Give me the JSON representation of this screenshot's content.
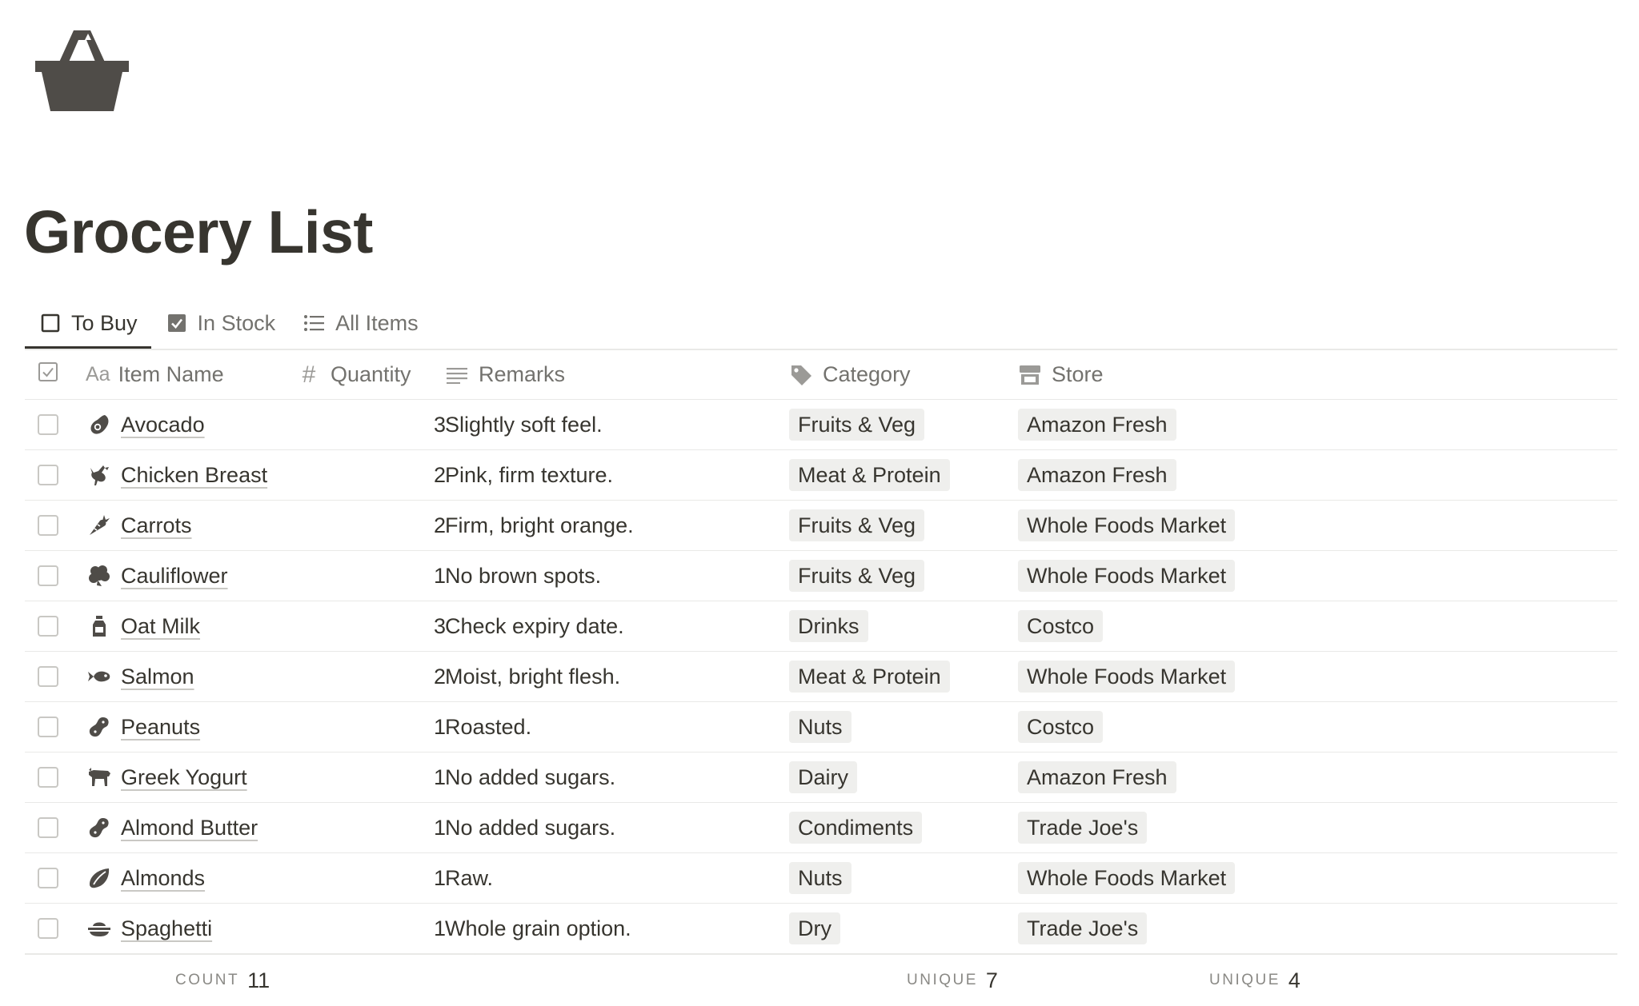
{
  "page": {
    "icon": "shopping-basket-icon",
    "title": "Grocery List"
  },
  "tabs": [
    {
      "label": "To Buy",
      "icon": "checkbox-empty-icon",
      "active": true
    },
    {
      "label": "In Stock",
      "icon": "checkbox-checked-icon",
      "active": false
    },
    {
      "label": "All Items",
      "icon": "list-icon",
      "active": false
    }
  ],
  "table": {
    "columns": {
      "name": {
        "label": "Item Name",
        "icon": "text-aa-icon"
      },
      "quantity": {
        "label": "Quantity",
        "icon": "hash-icon"
      },
      "remarks": {
        "label": "Remarks",
        "icon": "lines-icon"
      },
      "category": {
        "label": "Category",
        "icon": "tag-icon"
      },
      "store": {
        "label": "Store",
        "icon": "store-icon"
      }
    },
    "rows": [
      {
        "name": "Avocado",
        "icon": "avocado-icon",
        "quantity": "3",
        "remarks": "Slightly soft feel.",
        "category": "Fruits & Veg",
        "store": "Amazon Fresh"
      },
      {
        "name": "Chicken Breast",
        "icon": "chicken-icon",
        "quantity": "2",
        "remarks": "Pink, firm texture.",
        "category": "Meat & Protein",
        "store": "Amazon Fresh"
      },
      {
        "name": "Carrots",
        "icon": "carrot-icon",
        "quantity": "2",
        "remarks": "Firm, bright orange.",
        "category": "Fruits & Veg",
        "store": "Whole Foods Market"
      },
      {
        "name": "Cauliflower",
        "icon": "cauliflower-icon",
        "quantity": "1",
        "remarks": "No brown spots.",
        "category": "Fruits & Veg",
        "store": "Whole Foods Market"
      },
      {
        "name": "Oat Milk",
        "icon": "milk-bottle-icon",
        "quantity": "3",
        "remarks": "Check expiry date.",
        "category": "Drinks",
        "store": "Costco"
      },
      {
        "name": "Salmon",
        "icon": "fish-icon",
        "quantity": "2",
        "remarks": "Moist, bright flesh.",
        "category": "Meat & Protein",
        "store": "Whole Foods Market"
      },
      {
        "name": "Peanuts",
        "icon": "peanut-icon",
        "quantity": "1",
        "remarks": "Roasted.",
        "category": "Nuts",
        "store": "Costco"
      },
      {
        "name": "Greek Yogurt",
        "icon": "cow-icon",
        "quantity": "1",
        "remarks": "No added sugars.",
        "category": "Dairy",
        "store": "Amazon Fresh"
      },
      {
        "name": "Almond Butter",
        "icon": "peanut-icon",
        "quantity": "1",
        "remarks": "No added sugars.",
        "category": "Condiments",
        "store": "Trade Joe's"
      },
      {
        "name": "Almonds",
        "icon": "almond-icon",
        "quantity": "1",
        "remarks": "Raw.",
        "category": "Nuts",
        "store": "Whole Foods Market"
      },
      {
        "name": "Spaghetti",
        "icon": "pasta-bowl-icon",
        "quantity": "1",
        "remarks": "Whole grain option.",
        "category": "Dry",
        "store": "Trade Joe's"
      }
    ],
    "footer": {
      "count": {
        "label": "COUNT",
        "value": "11"
      },
      "category_unique": {
        "label": "UNIQUE",
        "value": "7"
      },
      "store_unique": {
        "label": "UNIQUE",
        "value": "4"
      }
    }
  },
  "colors": {
    "text": "#37352f",
    "muted": "#73726e",
    "tag_bg": "#efefed",
    "border": "#e9e9e7",
    "icon": "#4f4c48"
  }
}
